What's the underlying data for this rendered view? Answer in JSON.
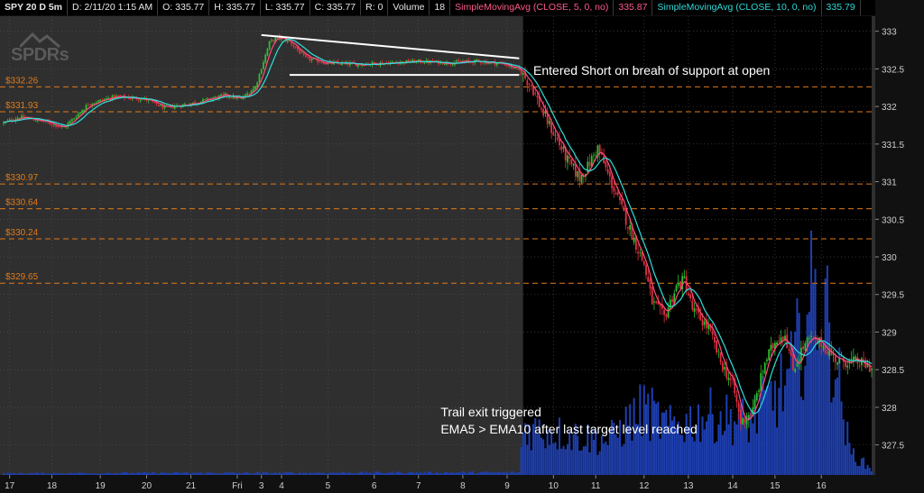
{
  "header": {
    "symbol": "SPY 20 D 5m",
    "date": "D: 2/11/20 1:15 AM",
    "open": "O: 335.77",
    "high": "H: 335.77",
    "low": "L: 335.77",
    "close": "C: 335.77",
    "range": "R: 0",
    "volume_label": "Volume",
    "volume_value": "18",
    "sma5_label": "SimpleMovingAvg (CLOSE, 5, 0, no)",
    "sma5_value": "335.87",
    "sma10_label": "SimpleMovingAvg (CLOSE, 10, 0, no)",
    "sma10_value": "335.79"
  },
  "logo": {
    "text": "SPDRs"
  },
  "corner_icon": "expand-icon",
  "colors": {
    "background": "#2f2f2f",
    "highlight_region": "#000000",
    "sma5": "#ff4d80",
    "sma10": "#2ee0e0",
    "level_line": "#e07a1a",
    "level_label": "#e07a1a",
    "candle_up": "#2fbf2f",
    "candle_down": "#e03040",
    "volume": "#1e3fb0",
    "trendline": "#ffffff",
    "annotation_text": "#ffffff"
  },
  "chart_data": {
    "type": "candlestick",
    "symbol": "SPY",
    "interval": "5m",
    "ylim": [
      327.1,
      333.2
    ],
    "y_ticks": [
      327.5,
      328,
      328.5,
      329,
      329.5,
      330,
      330.5,
      331,
      331.5,
      332,
      332.5,
      333
    ],
    "y_tick_labels": [
      "327.5",
      "328",
      "328.5",
      "329",
      "329.5",
      "330",
      "330.5",
      "331",
      "331.5",
      "332",
      "332.5",
      "333"
    ],
    "x_ticks": [
      {
        "label": "17",
        "index": 3
      },
      {
        "label": "18",
        "index": 24
      },
      {
        "label": "19",
        "index": 48
      },
      {
        "label": "20",
        "index": 71
      },
      {
        "label": "21",
        "index": 93
      },
      {
        "label": "Fri",
        "index": 116
      },
      {
        "label": "3",
        "index": 128
      },
      {
        "label": "4",
        "index": 138
      },
      {
        "label": "5",
        "index": 161
      },
      {
        "label": "6",
        "index": 184
      },
      {
        "label": "7",
        "index": 206
      },
      {
        "label": "8",
        "index": 228
      },
      {
        "label": "9",
        "index": 250
      },
      {
        "label": "10",
        "index": 273
      },
      {
        "label": "11",
        "index": 294
      },
      {
        "label": "12",
        "index": 318
      },
      {
        "label": "13",
        "index": 340
      },
      {
        "label": "14",
        "index": 362
      },
      {
        "label": "15",
        "index": 383
      },
      {
        "label": "16",
        "index": 406
      }
    ],
    "highlight_start_index": 257,
    "highlight_end_index": 431,
    "levels": [
      {
        "value": 332.26,
        "label": "$332.26"
      },
      {
        "value": 331.93,
        "label": "$331.93"
      },
      {
        "value": 330.97,
        "label": "$330.97"
      },
      {
        "value": 330.64,
        "label": "$330.64"
      },
      {
        "value": 330.24,
        "label": "$330.24"
      },
      {
        "value": 329.65,
        "label": "$329.65"
      }
    ],
    "close_anchors": [
      [
        0,
        331.78
      ],
      [
        8,
        331.86
      ],
      [
        20,
        331.8
      ],
      [
        30,
        331.72
      ],
      [
        42,
        332.03
      ],
      [
        55,
        332.13
      ],
      [
        70,
        332.1
      ],
      [
        80,
        331.98
      ],
      [
        95,
        332.05
      ],
      [
        110,
        332.15
      ],
      [
        118,
        332.1
      ],
      [
        125,
        332.26
      ],
      [
        132,
        332.85
      ],
      [
        136,
        332.92
      ],
      [
        142,
        332.86
      ],
      [
        150,
        332.64
      ],
      [
        160,
        332.58
      ],
      [
        175,
        332.56
      ],
      [
        190,
        332.58
      ],
      [
        205,
        332.6
      ],
      [
        220,
        332.58
      ],
      [
        235,
        332.6
      ],
      [
        248,
        332.57
      ],
      [
        256,
        332.48
      ],
      [
        262,
        332.28
      ],
      [
        268,
        331.9
      ],
      [
        274,
        331.6
      ],
      [
        280,
        331.28
      ],
      [
        286,
        331.05
      ],
      [
        290,
        331.2
      ],
      [
        295,
        331.45
      ],
      [
        300,
        331.1
      ],
      [
        306,
        330.7
      ],
      [
        312,
        330.3
      ],
      [
        318,
        329.9
      ],
      [
        322,
        329.4
      ],
      [
        328,
        329.2
      ],
      [
        334,
        329.6
      ],
      [
        338,
        329.7
      ],
      [
        342,
        329.3
      ],
      [
        350,
        329.05
      ],
      [
        356,
        328.6
      ],
      [
        362,
        328.3
      ],
      [
        366,
        327.8
      ],
      [
        372,
        327.95
      ],
      [
        378,
        328.6
      ],
      [
        384,
        328.92
      ],
      [
        388,
        328.98
      ],
      [
        392,
        328.5
      ],
      [
        396,
        328.75
      ],
      [
        400,
        328.9
      ],
      [
        406,
        328.85
      ],
      [
        414,
        328.62
      ],
      [
        424,
        328.6
      ],
      [
        431,
        328.52
      ]
    ],
    "volume_profile": [
      [
        0,
        2
      ],
      [
        256,
        3
      ],
      [
        258,
        55
      ],
      [
        300,
        40
      ],
      [
        318,
        78
      ],
      [
        330,
        55
      ],
      [
        350,
        70
      ],
      [
        370,
        62
      ],
      [
        390,
        110
      ],
      [
        404,
        220
      ],
      [
        412,
        150
      ],
      [
        420,
        28
      ],
      [
        431,
        6
      ]
    ],
    "series": [
      {
        "name": "SimpleMovingAvg (CLOSE, 5, 0, no)",
        "period": 5
      },
      {
        "name": "SimpleMovingAvg (CLOSE, 10, 0, no)",
        "period": 10
      }
    ],
    "trendlines": [
      {
        "start": [
          128,
          332.95
        ],
        "end": [
          256,
          332.64
        ]
      },
      {
        "start": [
          142,
          332.42
        ],
        "end": [
          256,
          332.42
        ]
      }
    ],
    "annotations": [
      {
        "text": "Entered Short on breah of support at open",
        "at": [
          263,
          332.42
        ]
      },
      {
        "text": "Trail exit triggered",
        "at": [
          217,
          327.88
        ]
      },
      {
        "text": "EMA5 > EMA10 after last target level reached",
        "at": [
          217,
          327.65
        ]
      }
    ]
  }
}
